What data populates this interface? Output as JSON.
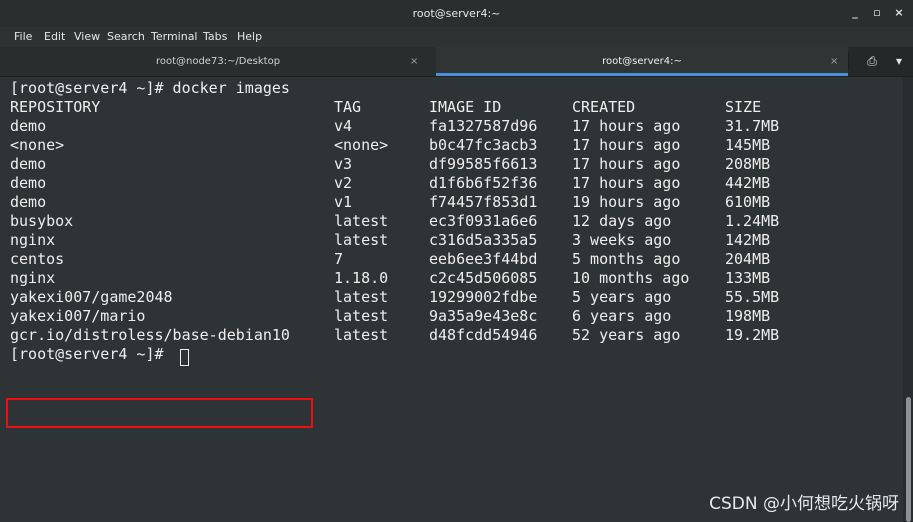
{
  "window": {
    "title": "root@server4:~",
    "minimize_label": "_",
    "maximize_label": "▫",
    "close_label": "×"
  },
  "menu": {
    "items": [
      "File",
      "Edit",
      "View",
      "Search",
      "Terminal",
      "Tabs",
      "Help"
    ]
  },
  "tabs": [
    {
      "label": "root@node73:~/Desktop",
      "close_label": "×",
      "active": false
    },
    {
      "label": "root@server4:~",
      "close_label": "×",
      "active": true
    }
  ],
  "tab_tools": {
    "new_tab_icon": "⎙",
    "menu_icon": "▾"
  },
  "terminal": {
    "prompt_command": "[root@server4 ~]# docker images",
    "headers": [
      "REPOSITORY",
      "TAG",
      "IMAGE ID",
      "CREATED",
      "SIZE"
    ],
    "rows": [
      [
        "demo",
        "v4",
        "fa1327587d96",
        "17 hours ago",
        "31.7MB"
      ],
      [
        "<none>",
        "<none>",
        "b0c47fc3acb3",
        "17 hours ago",
        "145MB"
      ],
      [
        "demo",
        "v3",
        "df99585f6613",
        "17 hours ago",
        "208MB"
      ],
      [
        "demo",
        "v2",
        "d1f6b6f52f36",
        "17 hours ago",
        "442MB"
      ],
      [
        "demo",
        "v1",
        "f74457f853d1",
        "19 hours ago",
        "610MB"
      ],
      [
        "busybox",
        "latest",
        "ec3f0931a6e6",
        "12 days ago",
        "1.24MB"
      ],
      [
        "nginx",
        "latest",
        "c316d5a335a5",
        "3 weeks ago",
        "142MB"
      ],
      [
        "centos",
        "7",
        "eeb6ee3f44bd",
        "5 months ago",
        "204MB"
      ],
      [
        "nginx",
        "1.18.0",
        "c2c45d506085",
        "10 months ago",
        "133MB"
      ],
      [
        "yakexi007/game2048",
        "latest",
        "19299002fdbe",
        "5 years ago",
        "55.5MB"
      ],
      [
        "yakexi007/mario",
        "latest",
        "9a35a9e43e8c",
        "6 years ago",
        "198MB"
      ],
      [
        "gcr.io/distroless/base-debian10",
        "latest",
        "d48fcdd54946",
        "52 years ago",
        "19.2MB"
      ]
    ],
    "final_prompt": "[root@server4 ~]# "
  },
  "watermark": "CSDN @小何想吃火锅呀",
  "colors": {
    "terminal_bg": "#2e3436",
    "terminal_fg": "#eeeeec",
    "highlight_box": "#ee1010",
    "active_tab_accent": "#4a90d9"
  }
}
